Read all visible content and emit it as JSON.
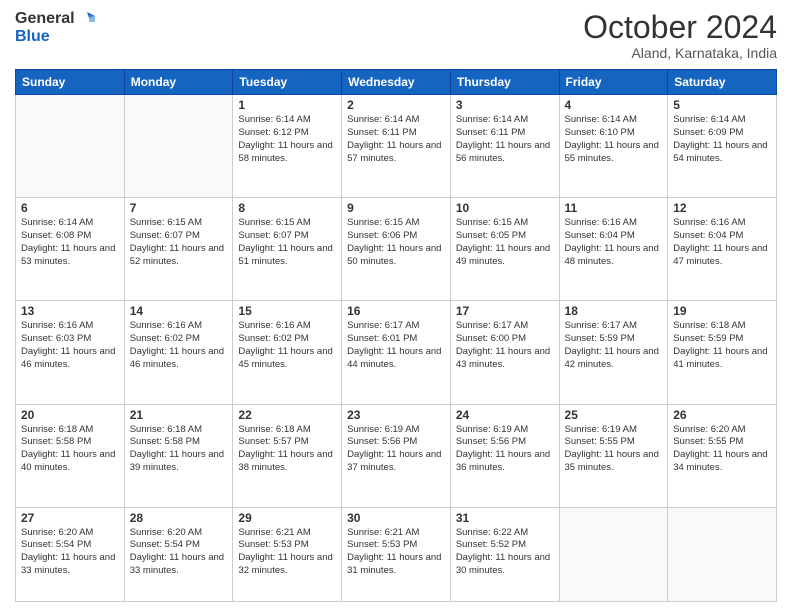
{
  "header": {
    "logo_line1": "General",
    "logo_line2": "Blue",
    "month": "October 2024",
    "location": "Aland, Karnataka, India"
  },
  "weekdays": [
    "Sunday",
    "Monday",
    "Tuesday",
    "Wednesday",
    "Thursday",
    "Friday",
    "Saturday"
  ],
  "weeks": [
    [
      {
        "day": "",
        "info": ""
      },
      {
        "day": "",
        "info": ""
      },
      {
        "day": "1",
        "info": "Sunrise: 6:14 AM\nSunset: 6:12 PM\nDaylight: 11 hours and 58 minutes."
      },
      {
        "day": "2",
        "info": "Sunrise: 6:14 AM\nSunset: 6:11 PM\nDaylight: 11 hours and 57 minutes."
      },
      {
        "day": "3",
        "info": "Sunrise: 6:14 AM\nSunset: 6:11 PM\nDaylight: 11 hours and 56 minutes."
      },
      {
        "day": "4",
        "info": "Sunrise: 6:14 AM\nSunset: 6:10 PM\nDaylight: 11 hours and 55 minutes."
      },
      {
        "day": "5",
        "info": "Sunrise: 6:14 AM\nSunset: 6:09 PM\nDaylight: 11 hours and 54 minutes."
      }
    ],
    [
      {
        "day": "6",
        "info": "Sunrise: 6:14 AM\nSunset: 6:08 PM\nDaylight: 11 hours and 53 minutes."
      },
      {
        "day": "7",
        "info": "Sunrise: 6:15 AM\nSunset: 6:07 PM\nDaylight: 11 hours and 52 minutes."
      },
      {
        "day": "8",
        "info": "Sunrise: 6:15 AM\nSunset: 6:07 PM\nDaylight: 11 hours and 51 minutes."
      },
      {
        "day": "9",
        "info": "Sunrise: 6:15 AM\nSunset: 6:06 PM\nDaylight: 11 hours and 50 minutes."
      },
      {
        "day": "10",
        "info": "Sunrise: 6:15 AM\nSunset: 6:05 PM\nDaylight: 11 hours and 49 minutes."
      },
      {
        "day": "11",
        "info": "Sunrise: 6:16 AM\nSunset: 6:04 PM\nDaylight: 11 hours and 48 minutes."
      },
      {
        "day": "12",
        "info": "Sunrise: 6:16 AM\nSunset: 6:04 PM\nDaylight: 11 hours and 47 minutes."
      }
    ],
    [
      {
        "day": "13",
        "info": "Sunrise: 6:16 AM\nSunset: 6:03 PM\nDaylight: 11 hours and 46 minutes."
      },
      {
        "day": "14",
        "info": "Sunrise: 6:16 AM\nSunset: 6:02 PM\nDaylight: 11 hours and 46 minutes."
      },
      {
        "day": "15",
        "info": "Sunrise: 6:16 AM\nSunset: 6:02 PM\nDaylight: 11 hours and 45 minutes."
      },
      {
        "day": "16",
        "info": "Sunrise: 6:17 AM\nSunset: 6:01 PM\nDaylight: 11 hours and 44 minutes."
      },
      {
        "day": "17",
        "info": "Sunrise: 6:17 AM\nSunset: 6:00 PM\nDaylight: 11 hours and 43 minutes."
      },
      {
        "day": "18",
        "info": "Sunrise: 6:17 AM\nSunset: 5:59 PM\nDaylight: 11 hours and 42 minutes."
      },
      {
        "day": "19",
        "info": "Sunrise: 6:18 AM\nSunset: 5:59 PM\nDaylight: 11 hours and 41 minutes."
      }
    ],
    [
      {
        "day": "20",
        "info": "Sunrise: 6:18 AM\nSunset: 5:58 PM\nDaylight: 11 hours and 40 minutes."
      },
      {
        "day": "21",
        "info": "Sunrise: 6:18 AM\nSunset: 5:58 PM\nDaylight: 11 hours and 39 minutes."
      },
      {
        "day": "22",
        "info": "Sunrise: 6:18 AM\nSunset: 5:57 PM\nDaylight: 11 hours and 38 minutes."
      },
      {
        "day": "23",
        "info": "Sunrise: 6:19 AM\nSunset: 5:56 PM\nDaylight: 11 hours and 37 minutes."
      },
      {
        "day": "24",
        "info": "Sunrise: 6:19 AM\nSunset: 5:56 PM\nDaylight: 11 hours and 36 minutes."
      },
      {
        "day": "25",
        "info": "Sunrise: 6:19 AM\nSunset: 5:55 PM\nDaylight: 11 hours and 35 minutes."
      },
      {
        "day": "26",
        "info": "Sunrise: 6:20 AM\nSunset: 5:55 PM\nDaylight: 11 hours and 34 minutes."
      }
    ],
    [
      {
        "day": "27",
        "info": "Sunrise: 6:20 AM\nSunset: 5:54 PM\nDaylight: 11 hours and 33 minutes."
      },
      {
        "day": "28",
        "info": "Sunrise: 6:20 AM\nSunset: 5:54 PM\nDaylight: 11 hours and 33 minutes."
      },
      {
        "day": "29",
        "info": "Sunrise: 6:21 AM\nSunset: 5:53 PM\nDaylight: 11 hours and 32 minutes."
      },
      {
        "day": "30",
        "info": "Sunrise: 6:21 AM\nSunset: 5:53 PM\nDaylight: 11 hours and 31 minutes."
      },
      {
        "day": "31",
        "info": "Sunrise: 6:22 AM\nSunset: 5:52 PM\nDaylight: 11 hours and 30 minutes."
      },
      {
        "day": "",
        "info": ""
      },
      {
        "day": "",
        "info": ""
      }
    ]
  ]
}
